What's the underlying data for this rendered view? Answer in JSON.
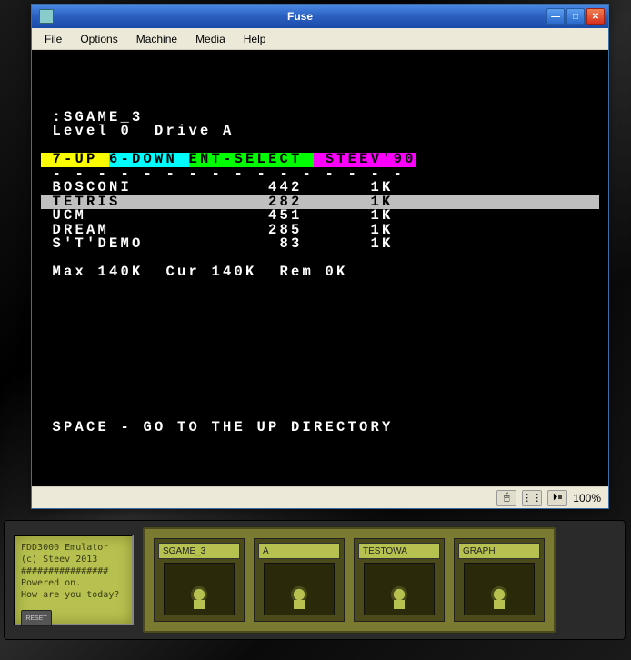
{
  "window": {
    "title": "Fuse",
    "zoom": "100%"
  },
  "menubar": [
    "File",
    "Options",
    "Machine",
    "Media",
    "Help"
  ],
  "screen": {
    "path_line": " :SGAME_3",
    "level_line": " Level 0  Drive A",
    "ctrl_segments": {
      "up": " 7-UP ",
      "down": "6-DOWN ",
      "sel": "ENT-SELECT ",
      "credit": " STEEV'90"
    },
    "dashes": " - - - - - - - - - - - - - - - -",
    "files": [
      {
        "name": "BOSCONI",
        "size": "442",
        "blocks": "1K",
        "selected": false
      },
      {
        "name": "TETRIS",
        "size": "282",
        "blocks": "1K",
        "selected": true
      },
      {
        "name": "UCM",
        "size": "451",
        "blocks": "1K",
        "selected": false
      },
      {
        "name": "DREAM",
        "size": "285",
        "blocks": "1K",
        "selected": false
      },
      {
        "name": "S'T'DEMO",
        "size": "83",
        "blocks": "1K",
        "selected": false
      }
    ],
    "summary": " Max 140K  Cur 140K  Rem 0K",
    "footer": " SPACE - GO TO THE UP DIRECTORY"
  },
  "device": {
    "lcd": [
      "FDD3000 Emulator",
      "(c) Steev 2013",
      "################",
      "Powered on.",
      "How are you today?"
    ],
    "reset": "RESET",
    "drives": [
      "SGAME_3",
      "A",
      "TESTOWA",
      "GRAPH"
    ]
  }
}
